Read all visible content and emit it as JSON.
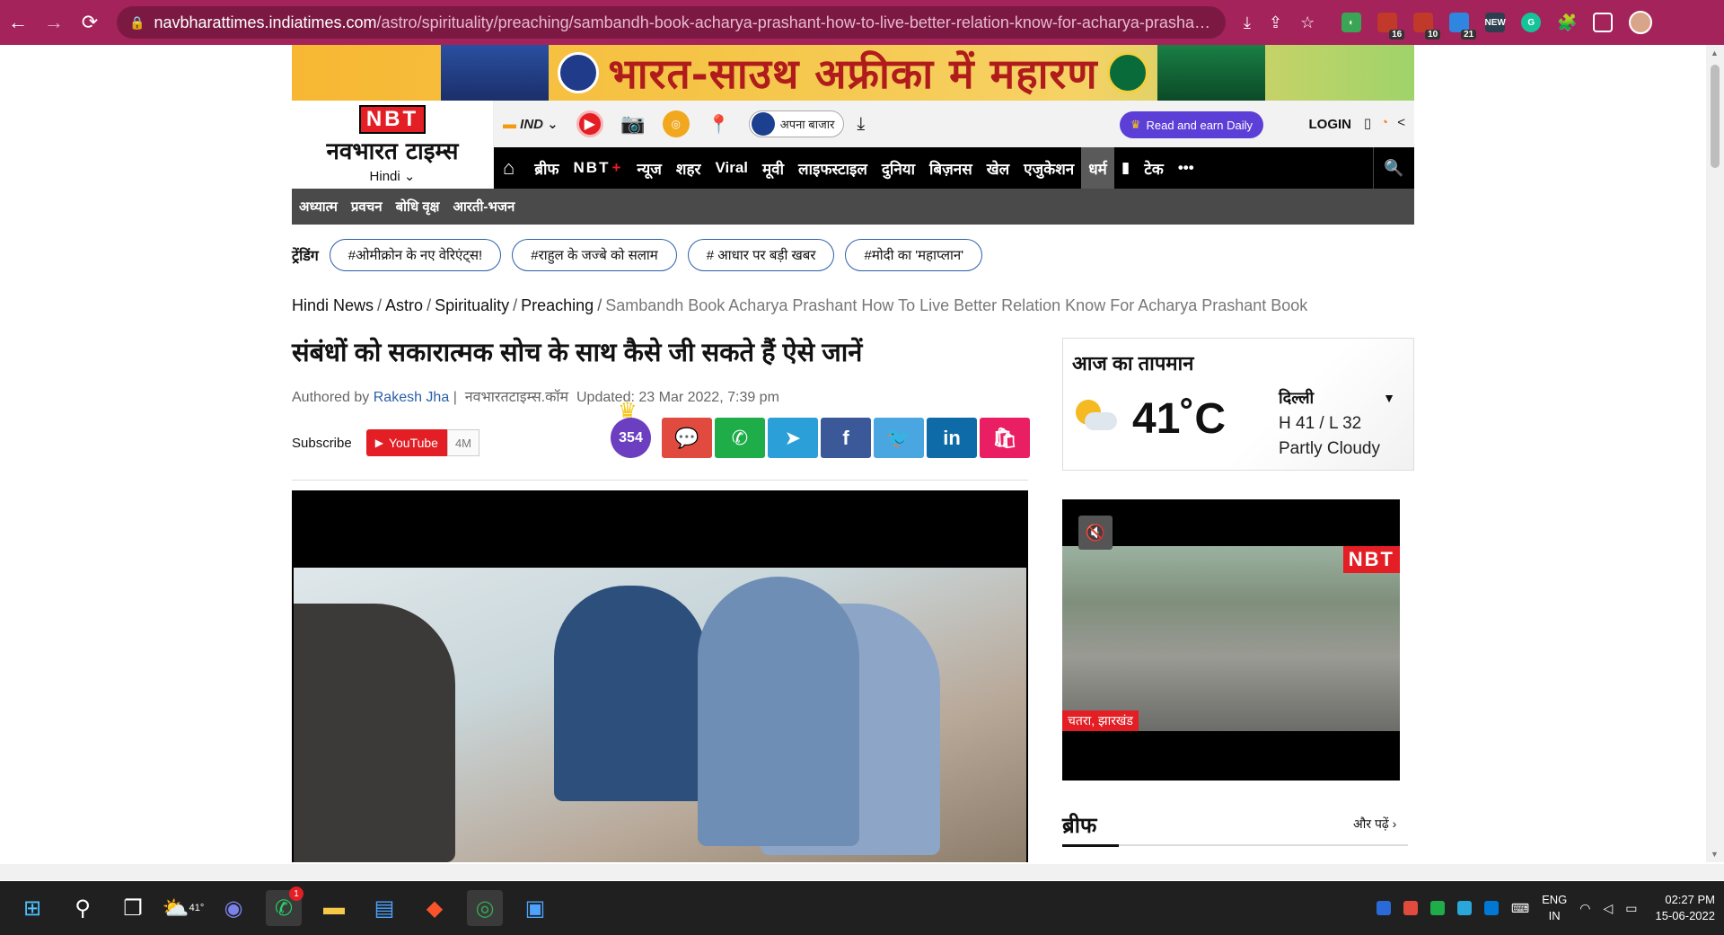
{
  "browser": {
    "url_domain": "navbharattimes.indiatimes.com",
    "url_path": "/astro/spirituality/preaching/sambandh-book-acharya-prashant-how-to-live-better-relation-know-for-acharya-prashant-b...",
    "extensions": [
      {
        "name": "abp-icon",
        "badge": "16",
        "color": "#c0392b"
      },
      {
        "name": "abp-alt-icon",
        "badge": "10",
        "color": "#c0392b"
      },
      {
        "name": "calendar-icon",
        "badge": "21",
        "color": "#2e86de"
      },
      {
        "name": "new-icon",
        "badge": "",
        "color": "#2c3e50",
        "label": "NEW"
      }
    ]
  },
  "banner": {
    "text": "भारत-साउथ अफ्रीका में महारण"
  },
  "masthead": {
    "logo_nbt": "NBT",
    "logo_hindi": "नवभारत टाइम्स",
    "logo_lang": "Hindi",
    "edition": "IND",
    "apna_bazaar": "अपना बाजार",
    "read_earn": "Read and earn Daily",
    "login": "LOGIN"
  },
  "nav": {
    "items": [
      "ब्रीफ",
      "NBT",
      "न्यूज",
      "शहर",
      "Viral",
      "मूवी",
      "लाइफस्टाइल",
      "दुनिया",
      "बिज़नस",
      "खेल",
      "एजुकेशन",
      "धर्म",
      "टेक",
      "•••"
    ],
    "nbt_plus": "+",
    "active": "धर्म"
  },
  "subnav": {
    "items": [
      "अध्यात्म",
      "प्रवचन",
      "बोधि वृक्ष",
      "आरती-भजन"
    ]
  },
  "trending": {
    "label": "ट्रेंडिंग",
    "tags": [
      "#ओमीक्रोन के नए वेरिएंट्स!",
      "#राहुल के जज्बे को सलाम",
      "# आधार पर बड़ी खबर",
      "#मोदी का 'महाप्लान'"
    ]
  },
  "breadcrumb": {
    "items": [
      "Hindi News",
      "Astro",
      "Spirituality",
      "Preaching"
    ],
    "current": "Sambandh Book Acharya Prashant How To Live Better Relation Know For Acharya Prashant Book"
  },
  "article": {
    "headline": "संबंधों को सकारात्मक सोच के साथ कैसे जी सकते हैं ऐसे जानें",
    "authored_by": "Authored by",
    "author": "Rakesh Jha",
    "sep": "|",
    "source": "नवभारतटाइम्स.कॉम",
    "updated": "Updated: 23 Mar 2022, 7:39 pm",
    "subscribe": "Subscribe",
    "youtube": "YouTube",
    "yt_count": "4M",
    "badge_count": "354"
  },
  "share_buttons": [
    {
      "name": "comment-button",
      "icon": "💬",
      "color": "#e04a3f"
    },
    {
      "name": "whatsapp-button",
      "icon": "✆",
      "color": "#1fad49"
    },
    {
      "name": "telegram-button",
      "icon": "➤",
      "color": "#2a9fd8"
    },
    {
      "name": "facebook-button",
      "icon": "f",
      "color": "#3b5998"
    },
    {
      "name": "twitter-button",
      "icon": "🐦",
      "color": "#4aa6e0"
    },
    {
      "name": "linkedin-button",
      "icon": "in",
      "color": "#0e6ba8"
    },
    {
      "name": "shop-button",
      "icon": "🛍",
      "color": "#e91e63"
    }
  ],
  "weather": {
    "title": "आज का तापमान",
    "temp": "41˚C",
    "city": "दिल्ली",
    "hl": "H 41 / L 32",
    "condition": "Partly Cloudy"
  },
  "side_video": {
    "brand": "NBT",
    "location": "चतरा, झारखंड"
  },
  "brief": {
    "title": "ब्रीफ",
    "more": "और पढ़ें"
  },
  "taskbar": {
    "weather_temp": "41°",
    "whatsapp_badge": "1",
    "lang_line1": "ENG",
    "lang_line2": "IN",
    "time": "02:27 PM",
    "date": "15-06-2022"
  }
}
